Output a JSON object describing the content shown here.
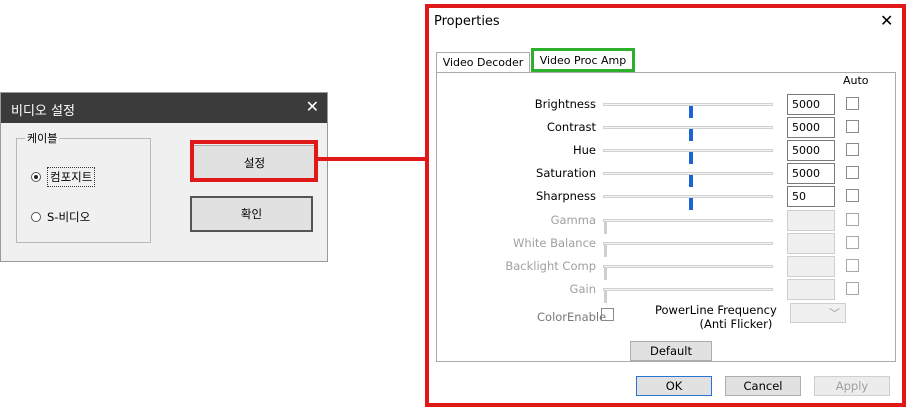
{
  "video_dialog": {
    "title": "비디오 설정",
    "close_glyph": "✕",
    "group_label": "케이블",
    "radio_composite": "컴포지트",
    "radio_svideo": "S-비디오",
    "settings_button": "설정",
    "ok_button": "확인"
  },
  "properties": {
    "title": "Properties",
    "close_glyph": "✕",
    "tabs": [
      {
        "label": "Video Decoder"
      },
      {
        "label": "Video Proc Amp"
      }
    ],
    "auto_header": "Auto",
    "rows": [
      {
        "label": "Brightness",
        "value": "5000",
        "level": 0.5,
        "enabled": true
      },
      {
        "label": "Contrast",
        "value": "5000",
        "level": 0.5,
        "enabled": true
      },
      {
        "label": "Hue",
        "value": "5000",
        "level": 0.5,
        "enabled": true
      },
      {
        "label": "Saturation",
        "value": "5000",
        "level": 0.5,
        "enabled": true
      },
      {
        "label": "Sharpness",
        "value": "50",
        "level": 0.5,
        "enabled": true
      },
      {
        "label": "Gamma",
        "value": "",
        "level": 0,
        "enabled": false
      },
      {
        "label": "White Balance",
        "value": "",
        "level": 0,
        "enabled": false
      },
      {
        "label": "Backlight Comp",
        "value": "",
        "level": 0,
        "enabled": false
      },
      {
        "label": "Gain",
        "value": "",
        "level": 0,
        "enabled": false
      }
    ],
    "color_enable_label": "ColorEnable",
    "powerline_label_1": "PowerLine Frequency",
    "powerline_label_2": "(Anti Flicker)",
    "powerline_chevron": "﹀",
    "default_button": "Default",
    "ok_button": "OK",
    "cancel_button": "Cancel",
    "apply_button": "Apply"
  },
  "colors": {
    "highlight_red": "#e01818",
    "active_tab_green": "#2db02d",
    "slider_thumb": "#1c64d6"
  }
}
